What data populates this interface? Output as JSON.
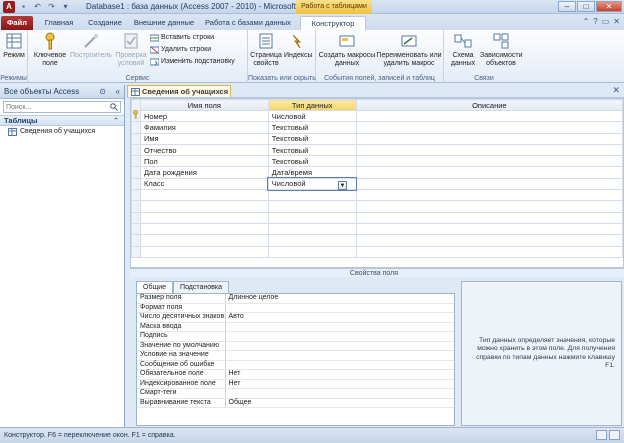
{
  "window": {
    "app_letter": "A",
    "title": "Database1 : база данных (Access 2007 - 2010) - Microsoft Ac...",
    "contextual_tab_group": "Работа с таблицами",
    "controls": {
      "minimize": "–",
      "maximize": "□",
      "close": "✕"
    }
  },
  "tabs": {
    "file": "Файл",
    "items": [
      "Главная",
      "Создание",
      "Внешние данные",
      "Работа с базами данных",
      "Конструктор"
    ]
  },
  "ribbon": {
    "groups": {
      "modes": {
        "label": "Режимы",
        "view": "Режим"
      },
      "service": {
        "label": "Сервис",
        "key_field": "Ключевое поле",
        "builder": "Построитель",
        "check_conditions": "Проверка условий",
        "insert_rows": "Вставить строки",
        "delete_rows": "Удалить строки",
        "change_lookup": "Изменить подстановку"
      },
      "show_hide": {
        "label": "Показать или скрыть",
        "property_sheet": "Страница свойств",
        "indexes": "Индексы"
      },
      "events": {
        "label": "События полей, записей и таблиц",
        "create_macros": "Создать макросы данных",
        "rename_delete_macro": "Переименовать или удалить макрос"
      },
      "relations": {
        "label": "Связи",
        "schema": "Схема данных",
        "dependencies": "Зависимости объектов"
      }
    }
  },
  "nav": {
    "header": "Все объекты Access",
    "search_placeholder": "Поиск...",
    "group": "Таблицы",
    "items": [
      "Сведения об учащихся"
    ]
  },
  "document": {
    "tab_title": "Сведения об учащихся",
    "columns": {
      "field": "Имя поля",
      "type": "Тип данных",
      "desc": "Описание"
    },
    "rows": [
      {
        "field": "Номер",
        "type": "Числовой"
      },
      {
        "field": "Фамилия",
        "type": "Текстовый"
      },
      {
        "field": "Имя",
        "type": "Текстовый"
      },
      {
        "field": "Отчество",
        "type": "Текстовый"
      },
      {
        "field": "Пол",
        "type": "Текстовый"
      },
      {
        "field": "Дата рождения",
        "type": "Дата/время"
      },
      {
        "field": "Класс",
        "type": "Числовой"
      }
    ],
    "props_caption": "Свойства поля"
  },
  "properties": {
    "tabs": [
      "Общие",
      "Подстановка"
    ],
    "rows": [
      {
        "name": "Размер поля",
        "value": "Длинное целое"
      },
      {
        "name": "Формат поля",
        "value": ""
      },
      {
        "name": "Число десятичных знаков",
        "value": "Авто"
      },
      {
        "name": "Маска ввода",
        "value": ""
      },
      {
        "name": "Подпись",
        "value": ""
      },
      {
        "name": "Значение по умолчанию",
        "value": ""
      },
      {
        "name": "Условие на значение",
        "value": ""
      },
      {
        "name": "Сообщение об ошибке",
        "value": ""
      },
      {
        "name": "Обязательное поле",
        "value": "Нет"
      },
      {
        "name": "Индексированное поле",
        "value": "Нет"
      },
      {
        "name": "Смарт-теги",
        "value": ""
      },
      {
        "name": "Выравнивание текста",
        "value": "Общее"
      }
    ],
    "help": "Тип данных определяет значения, которые можно хранить в этом поле. Для получения справки по типам данных нажмите клавишу F1."
  },
  "status": {
    "text": "Конструктор.  F6 = переключение окон.  F1 = справка."
  },
  "colors": {
    "file_tab": "#9b1b1b",
    "context_tab": "#f0c040",
    "active_header": "#f5d569"
  }
}
